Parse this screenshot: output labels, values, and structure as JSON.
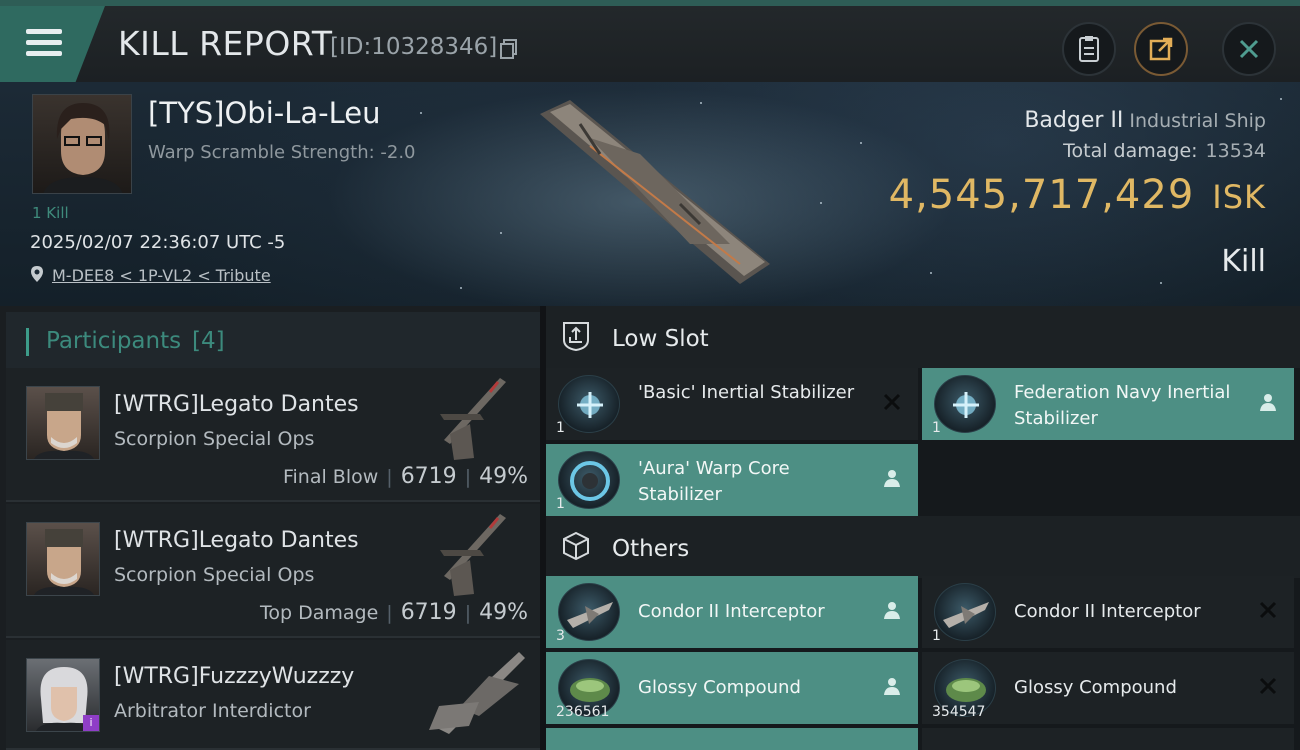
{
  "header": {
    "title": "KILL REPORT",
    "kill_id": "[ID:10328346]",
    "menu_icon": "hamburger-icon",
    "copy_icon": "copy-icon",
    "actions": [
      "clipboard-icon",
      "share-icon",
      "close-icon"
    ]
  },
  "victim": {
    "name": "[TYS]Obi-La-Leu",
    "warp_scramble": "Warp Scramble Strength: -2.0",
    "kill_count": "1 Kill",
    "datetime": "2025/02/07 22:36:07 UTC -5",
    "location": "M-DEE8 < 1P-VL2 < Tribute",
    "ship_name": "Badger II",
    "ship_class": "Industrial Ship",
    "total_damage_label": "Total damage:",
    "total_damage_value": "13534",
    "isk_value": "4,545,717,429",
    "isk_unit": "ISK",
    "result": "Kill"
  },
  "participants": {
    "title": "Participants",
    "count": "[4]",
    "rows": [
      {
        "name": "[WTRG]Legato Dantes",
        "ship": "Scorpion Special Ops",
        "role": "Final Blow",
        "damage": "6719",
        "percent": "49%"
      },
      {
        "name": "[WTRG]Legato Dantes",
        "ship": "Scorpion Special Ops",
        "role": "Top Damage",
        "damage": "6719",
        "percent": "49%"
      },
      {
        "name": "[WTRG]FuzzzyWuzzzy",
        "ship": "Arbitrator Interdictor",
        "role": "",
        "damage": "",
        "percent": ""
      }
    ]
  },
  "low_slot": {
    "title": "Low Slot",
    "items": [
      {
        "name": "'Basic' Inertial Stabilizer",
        "qty": "1",
        "status": "destroyed"
      },
      {
        "name": "Federation Navy Inertial Stabilizer",
        "qty": "1",
        "status": "dropped"
      },
      {
        "name": "'Aura' Warp Core Stabilizer",
        "qty": "1",
        "status": "dropped"
      }
    ]
  },
  "others": {
    "title": "Others",
    "items": [
      {
        "name": "Condor II Interceptor",
        "qty": "3",
        "status": "dropped"
      },
      {
        "name": "Condor II Interceptor",
        "qty": "1",
        "status": "destroyed"
      },
      {
        "name": "Glossy Compound",
        "qty": "236561",
        "status": "dropped"
      },
      {
        "name": "Glossy Compound",
        "qty": "354547",
        "status": "destroyed"
      }
    ]
  },
  "colors": {
    "accent_teal": "#4d8f84",
    "isk_gold": "#e0b864",
    "badge_purple": "#8f3ec7"
  }
}
